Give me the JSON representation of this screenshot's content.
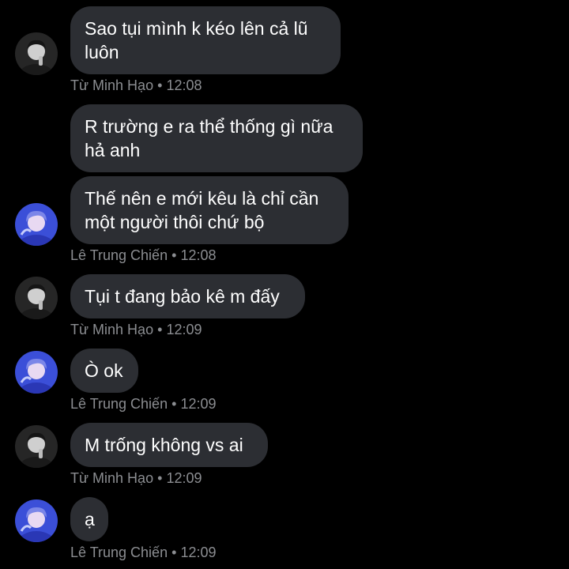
{
  "messages": [
    {
      "sender": "minh",
      "lines": [
        "Sao tụi mình k kéo lên cả lũ",
        "luôn"
      ]
    },
    {
      "sender": "chien",
      "lines": [
        "R trường e ra thể thống gì nữa",
        "hả anh"
      ]
    },
    {
      "sender": "chien",
      "lines": [
        "Thế nên e mới kêu là chỉ cần",
        "một người thôi chứ bộ"
      ]
    },
    {
      "sender": "minh",
      "lines": [
        "Tụi t đang bảo kê m đấy"
      ]
    },
    {
      "sender": "chien",
      "lines": [
        "Ò ok"
      ]
    },
    {
      "sender": "minh",
      "lines": [
        "M trống không vs ai"
      ]
    },
    {
      "sender": "chien",
      "lines": [
        "ạ"
      ]
    }
  ],
  "meta": [
    {
      "name": "Từ Minh Hạo",
      "time": "12:08"
    },
    {
      "name": "Lê Trung Chiến",
      "time": "12:08"
    },
    {
      "name": "Từ Minh Hạo",
      "time": "12:09"
    },
    {
      "name": "Lê Trung Chiến",
      "time": "12:09"
    },
    {
      "name": "Từ Minh Hạo",
      "time": "12:09"
    },
    {
      "name": "Lê Trung Chiến",
      "time": "12:09"
    }
  ],
  "separator": "•",
  "avatars": {
    "minh": {
      "icon": "grayscale-portrait-avatar",
      "bg": "#2a2a2a"
    },
    "chien": {
      "icon": "blue-portrait-avatar",
      "bg": "#3b4fd8"
    }
  },
  "colors": {
    "background": "#000000",
    "bubble": "#2c2e33",
    "text": "#ffffff",
    "meta": "#8b8d91"
  }
}
